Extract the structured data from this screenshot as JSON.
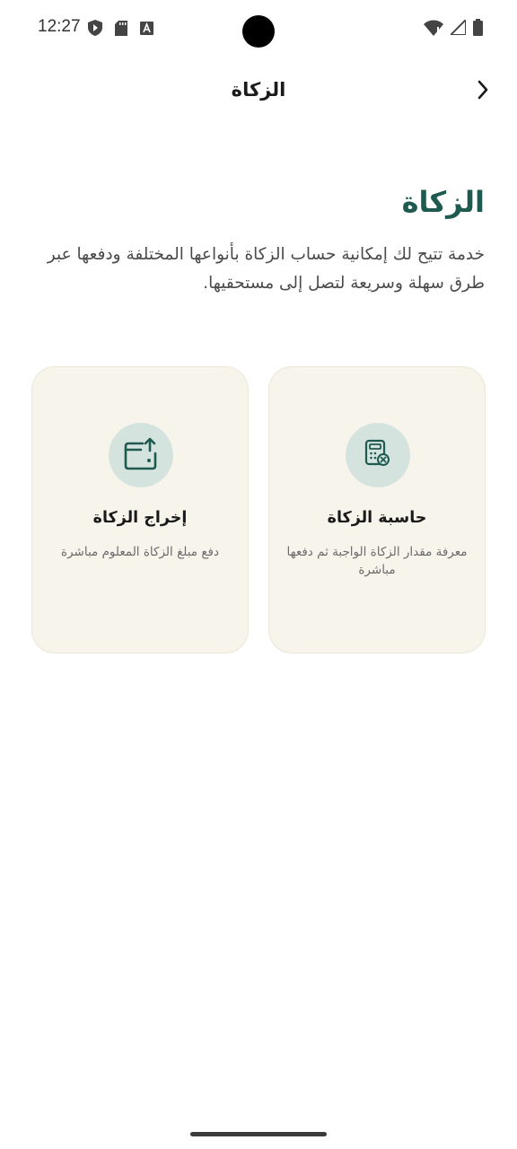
{
  "status_bar": {
    "time": "12:27",
    "icons_left": [
      "shield-play-icon",
      "sd-card-icon",
      "font-a-icon"
    ],
    "icons_right": [
      "wifi-icon",
      "signal-icon",
      "battery-icon"
    ]
  },
  "app_bar": {
    "title": "الزكاة",
    "back_icon": "chevron-right-icon"
  },
  "page": {
    "heading": "الزكاة",
    "description": "خدمة تتيح لك إمكانية حساب الزكاة بأنواعها المختلفة ودفعها عبر طرق سهلة وسريعة لتصل إلى مستحقيها."
  },
  "cards": [
    {
      "title": "حاسبة الزكاة",
      "description": "معرفة مقدار الزكاة الواجبة ثم دفعها مباشرة",
      "icon": "calculator-icon"
    },
    {
      "title": "إخراج الزكاة",
      "description": "دفع مبلغ الزكاة المعلوم مباشرة",
      "icon": "wallet-upload-icon"
    }
  ],
  "colors": {
    "accent": "#1e5a4f",
    "card_bg": "#f7f4ec",
    "icon_circle": "#d5e3df"
  }
}
